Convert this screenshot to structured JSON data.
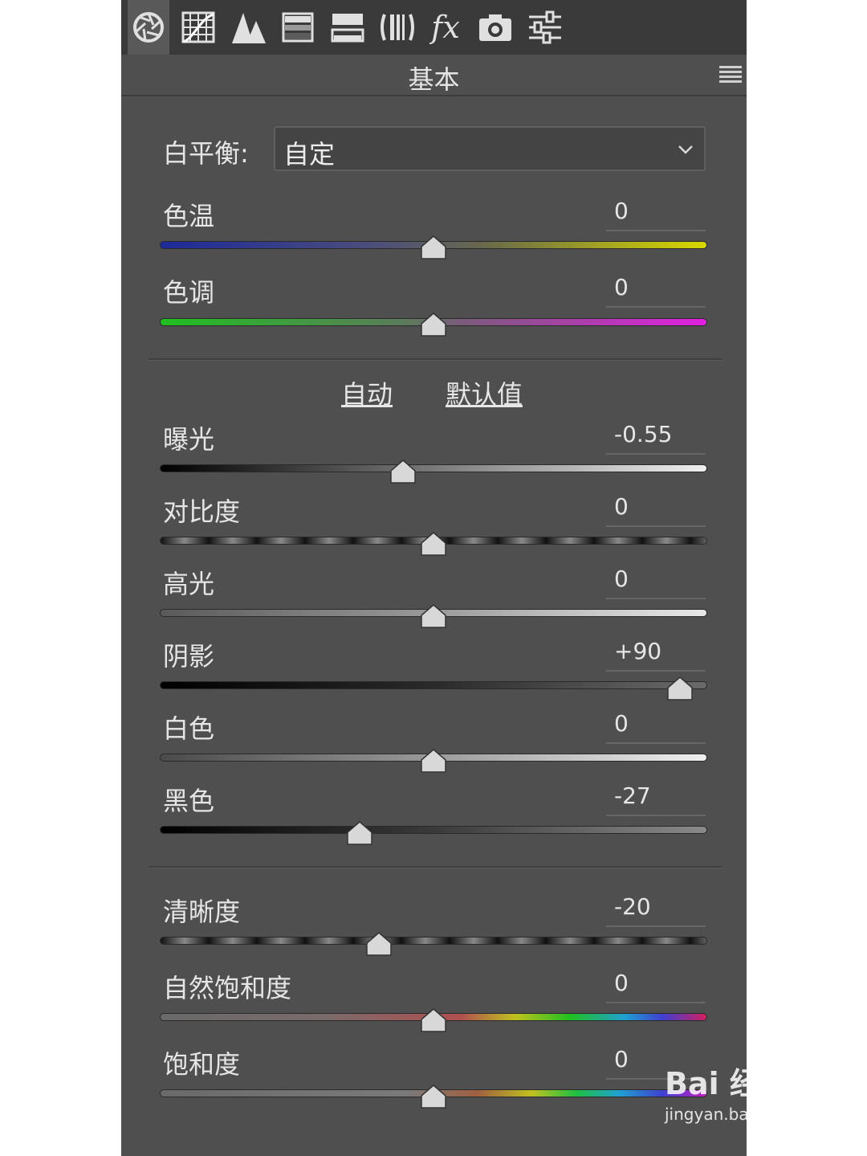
{
  "toolbar": {
    "tools": [
      {
        "name": "basic-aperture-icon",
        "active": true
      },
      {
        "name": "tone-curve-grid-icon"
      },
      {
        "name": "detail-mountains-icon"
      },
      {
        "name": "hsl-gradient-icon"
      },
      {
        "name": "split-toning-icon"
      },
      {
        "name": "lens-correction-icon"
      },
      {
        "name": "effects-fx-icon",
        "text": "fx"
      },
      {
        "name": "camera-calibration-icon"
      },
      {
        "name": "presets-sliders-icon"
      }
    ]
  },
  "header": {
    "title": "基本"
  },
  "white_balance": {
    "label": "白平衡:",
    "value": "自定"
  },
  "sliders_wb": [
    {
      "label": "色温",
      "value": "0",
      "level": 0.5
    },
    {
      "label": "色调",
      "value": "0",
      "level": 0.5
    }
  ],
  "links": {
    "auto": "自动",
    "default": "默认值"
  },
  "sliders_tone": [
    {
      "label": "曝光",
      "value": "-0.55",
      "level": 0.445
    },
    {
      "label": "对比度",
      "value": "0",
      "level": 0.5
    },
    {
      "label": "高光",
      "value": "0",
      "level": 0.5
    },
    {
      "label": "阴影",
      "value": "+90",
      "level": 0.95
    },
    {
      "label": "白色",
      "value": "0",
      "level": 0.5
    },
    {
      "label": "黑色",
      "value": "-27",
      "level": 0.365
    }
  ],
  "sliders_presence": [
    {
      "label": "清晰度",
      "value": "-20",
      "level": 0.4
    },
    {
      "label": "自然饱和度",
      "value": "0",
      "level": 0.5
    },
    {
      "label": "饱和度",
      "value": "0",
      "level": 0.5
    }
  ],
  "watermark": {
    "logo": "Bai 经验",
    "url": "jingyan.baidu.com"
  }
}
